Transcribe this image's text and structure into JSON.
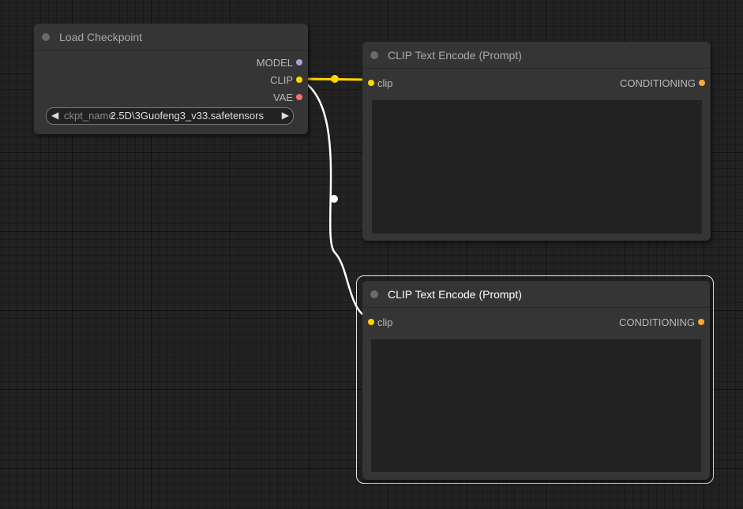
{
  "canvas": {
    "background": "#222222"
  },
  "colors": {
    "model": "#b39ddb",
    "clip": "#ffd500",
    "vae": "#ff6e6e",
    "conditioning": "#ffa931"
  },
  "nodes": {
    "load_checkpoint": {
      "title": "Load Checkpoint",
      "outputs": {
        "model": "MODEL",
        "clip": "CLIP",
        "vae": "VAE"
      },
      "widget": {
        "label": "ckpt_name",
        "value": "2.5D\\3Guofeng3_v33.safetensors",
        "left_arrow": "◀",
        "right_arrow": "▶"
      }
    },
    "clip_text_encode_1": {
      "title": "CLIP Text Encode (Prompt)",
      "input": {
        "clip": "clip"
      },
      "output": {
        "conditioning": "CONDITIONING"
      },
      "text": ""
    },
    "clip_text_encode_2": {
      "title": "CLIP Text Encode (Prompt)",
      "input": {
        "clip": "clip"
      },
      "output": {
        "conditioning": "CONDITIONING"
      },
      "text": "",
      "selected": true
    }
  }
}
